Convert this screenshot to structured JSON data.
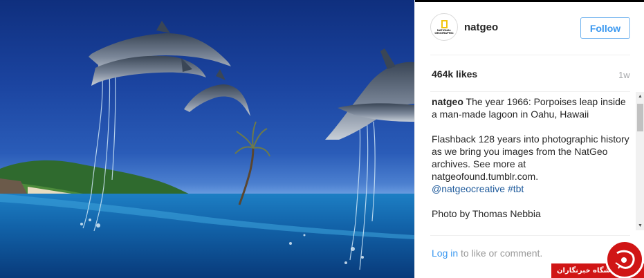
{
  "post": {
    "username": "natgeo",
    "follow_label": "Follow",
    "avatar_text": "NATIONAL GEOGRAPHIC",
    "likes": "464k likes",
    "age": "1w",
    "caption": {
      "user": "natgeo",
      "lines": [
        "The year 1966: Porpoises leap inside a man-made lagoon in Oahu, Hawaii",
        "Flashback 128 years into photographic history as we bring you images from the NatGeo archives. See more at natgeofound.tumblr.com."
      ],
      "tags": "@natgeocreative #tbt",
      "credit": "Photo by Thomas Nebbia"
    },
    "login_link": "Log in",
    "login_suffix": " to like or comment."
  },
  "watermark": {
    "text": "باشگاه خبرنگاران"
  },
  "colors": {
    "accent": "#3897f0",
    "watermark_red": "#d01515"
  }
}
